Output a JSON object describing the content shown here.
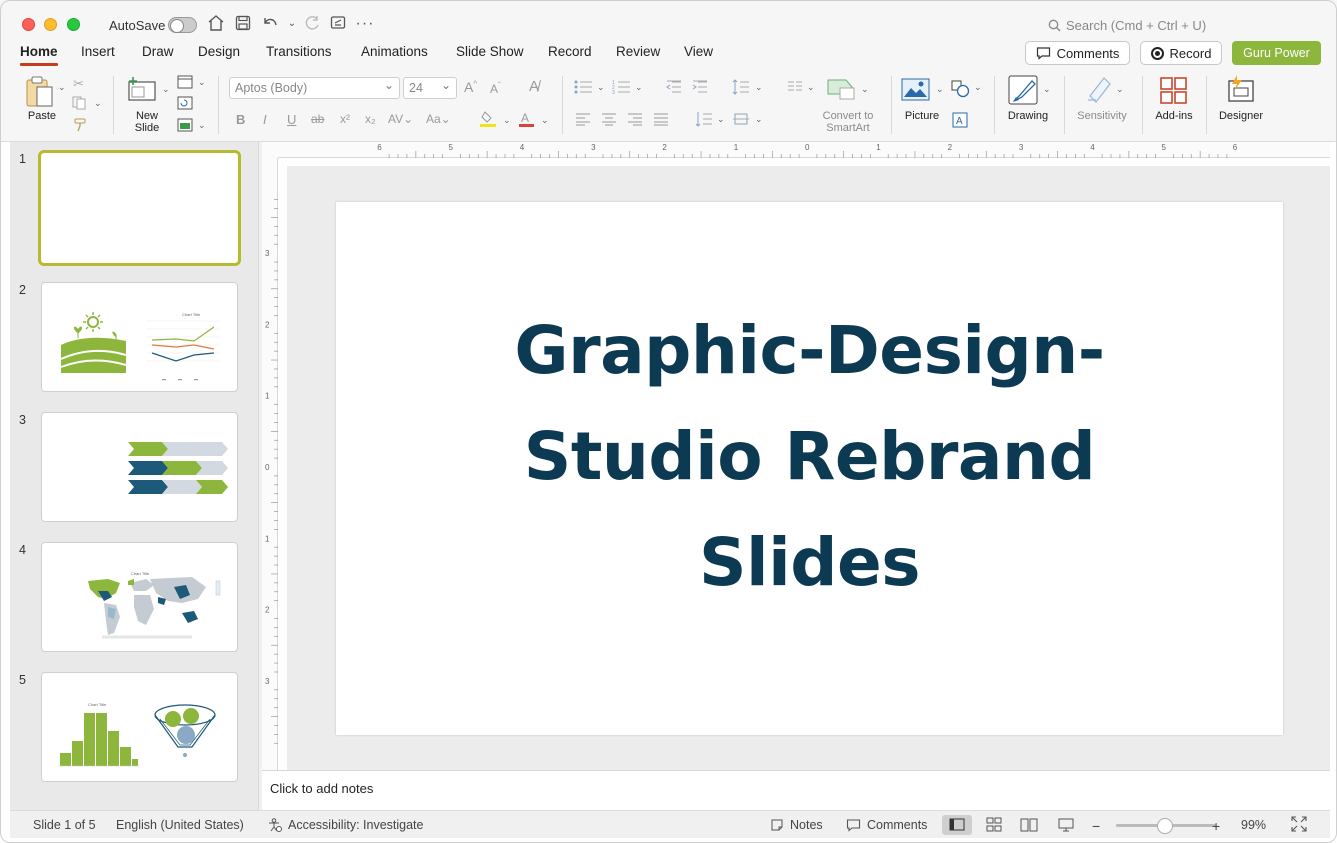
{
  "titlebar": {
    "autosave_label": "AutoSave",
    "search_placeholder": "Search (Cmd + Ctrl + U)"
  },
  "tabs": [
    {
      "label": "Home",
      "active": true
    },
    {
      "label": "Insert"
    },
    {
      "label": "Draw"
    },
    {
      "label": "Design"
    },
    {
      "label": "Transitions"
    },
    {
      "label": "Animations"
    },
    {
      "label": "Slide Show"
    },
    {
      "label": "Record"
    },
    {
      "label": "Review"
    },
    {
      "label": "View"
    }
  ],
  "header_actions": {
    "comments_label": "Comments",
    "record_label": "Record",
    "guru_label": "Guru Power"
  },
  "ribbon": {
    "paste_label": "Paste",
    "new_slide_label_1": "New",
    "new_slide_label_2": "Slide",
    "font_name": "Aptos (Body)",
    "font_size": "24",
    "convert_label_1": "Convert to",
    "convert_label_2": "SmartArt",
    "picture_label": "Picture",
    "drawing_label": "Drawing",
    "sensitivity_label": "Sensitivity",
    "addins_label": "Add-ins",
    "designer_label": "Designer"
  },
  "thumbnails": [
    {
      "number": "1",
      "selected": true
    },
    {
      "number": "2"
    },
    {
      "number": "3"
    },
    {
      "number": "4"
    },
    {
      "number": "5"
    }
  ],
  "rulers": {
    "horizontal": [
      "6",
      "5",
      "4",
      "3",
      "2",
      "1",
      "0",
      "1",
      "2",
      "3",
      "4",
      "5",
      "6"
    ],
    "vertical": [
      "3",
      "2",
      "1",
      "0",
      "1",
      "2",
      "3"
    ]
  },
  "slide": {
    "title_line1": "Graphic-Design-",
    "title_line2": "Studio Rebrand",
    "title_line3": "Slides",
    "title_color": "#0c3a52"
  },
  "notes": {
    "placeholder": "Click to add notes"
  },
  "status": {
    "slide_count": "Slide 1 of 5",
    "language": "English (United States)",
    "accessibility": "Accessibility: Investigate",
    "notes_label": "Notes",
    "comments_label": "Comments",
    "zoom": "99%"
  },
  "colors": {
    "accent_green": "#8db63c",
    "accent_navy": "#1d5a7a",
    "tab_underline": "#c43e1c"
  }
}
